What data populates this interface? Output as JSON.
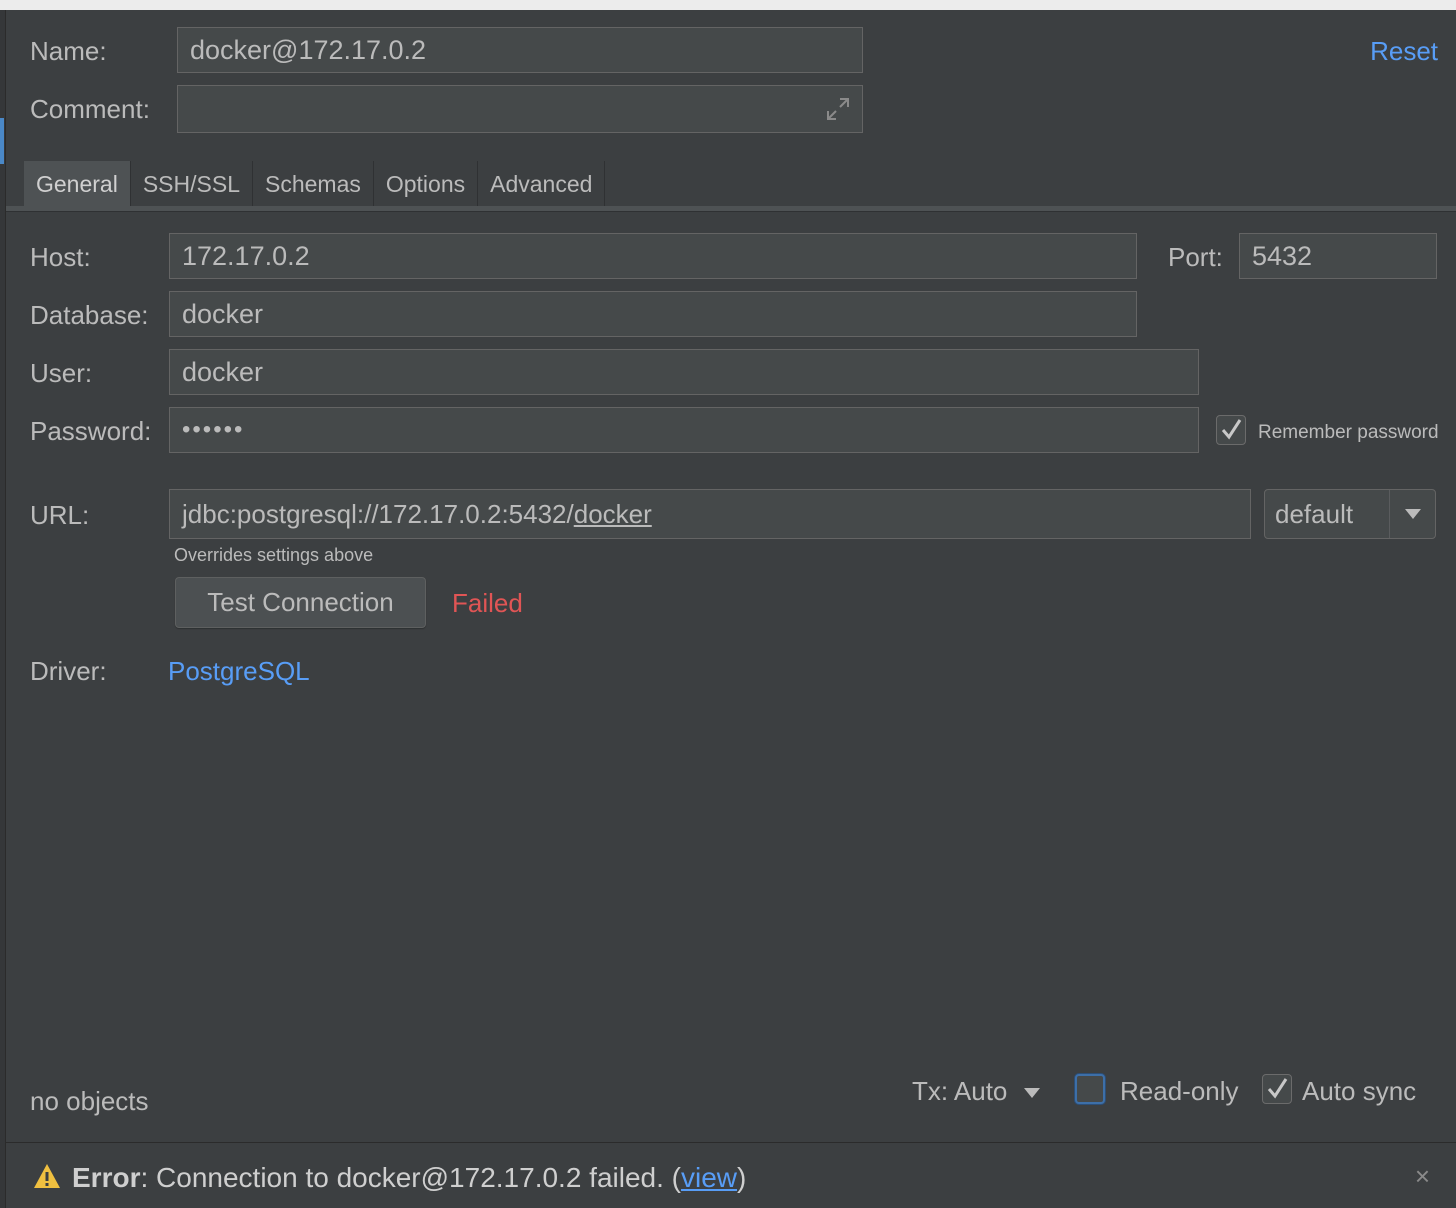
{
  "header": {
    "name_label": "Name:",
    "name_value": "docker@172.17.0.2",
    "comment_label": "Comment:",
    "comment_value": "",
    "reset_label": "Reset"
  },
  "tabs": [
    {
      "label": "General",
      "active": true
    },
    {
      "label": "SSH/SSL",
      "active": false
    },
    {
      "label": "Schemas",
      "active": false
    },
    {
      "label": "Options",
      "active": false
    },
    {
      "label": "Advanced",
      "active": false
    }
  ],
  "general": {
    "host_label": "Host:",
    "host_value": "172.17.0.2",
    "port_label": "Port:",
    "port_value": "5432",
    "database_label": "Database:",
    "database_value": "docker",
    "user_label": "User:",
    "user_value": "docker",
    "password_label": "Password:",
    "password_value": "••••••",
    "remember_password_label": "Remember password",
    "remember_password_checked": true,
    "url_label": "URL:",
    "url_prefix": "jdbc:postgresql://172.17.0.2:5432/",
    "url_db": "docker",
    "url_mode": "default",
    "url_hint": "Overrides settings above",
    "test_connection_label": "Test Connection",
    "test_status": "Failed",
    "driver_label": "Driver:",
    "driver_value": "PostgreSQL"
  },
  "footer": {
    "objects": "no objects",
    "tx_label": "Tx: Auto",
    "readonly_label": "Read-only",
    "readonly_checked": false,
    "autosync_label": "Auto sync",
    "autosync_checked": true
  },
  "status": {
    "error_prefix": "Error",
    "error_colon": ":",
    "error_message": " Connection to docker@172.17.0.2 failed. (",
    "view_link": "view",
    "close_paren": ")",
    "close_glyph": "×"
  },
  "colors": {
    "background": "#3c3f41",
    "field": "#45494a",
    "link": "#589df6",
    "error": "#e05555",
    "warning": "#f0c040"
  }
}
